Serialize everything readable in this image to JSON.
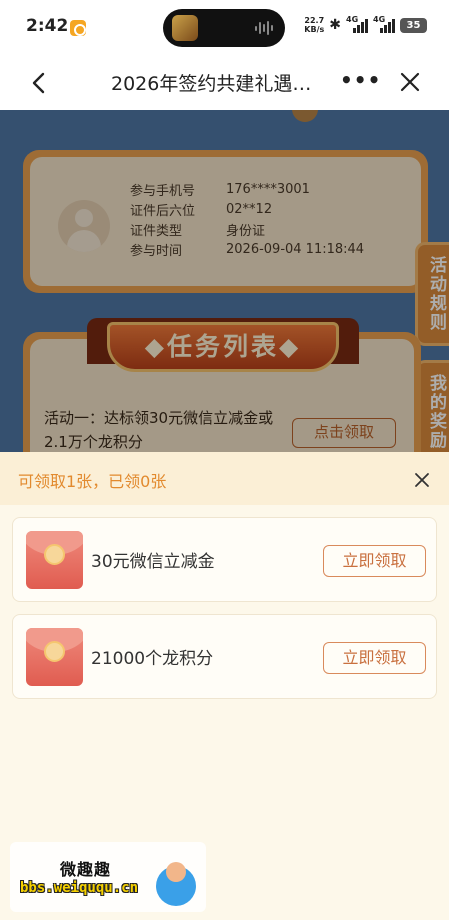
{
  "status_bar": {
    "time": "2:42",
    "net_speed_value": "22.7",
    "net_speed_unit": "KB/s",
    "signal_1_label": "4G",
    "signal_2_label": "4G",
    "battery": "35"
  },
  "title_bar": {
    "title": "2026年签约共建礼遇…"
  },
  "background_page": {
    "info_card": {
      "rows": [
        {
          "label": "参与手机号",
          "value": "176****3001"
        },
        {
          "label": "证件后六位",
          "value": "02**12"
        },
        {
          "label": "证件类型",
          "value": "身份证"
        },
        {
          "label": "参与时间",
          "value": "2026-09-04 11:18:44"
        }
      ]
    },
    "side_tabs": {
      "rules": "活动规则",
      "my_rewards": "我的奖励"
    },
    "task_section": {
      "banner": "◆任务列表◆",
      "activity_text": "活动一：达标领30元微信立减金或2.1万个龙积分",
      "claim_button": "点击领取"
    }
  },
  "sheet": {
    "header_text": "可领取1张，已领0张",
    "coupons": [
      {
        "title": "30元微信立减金",
        "button": "立即领取"
      },
      {
        "title": "21000个龙积分",
        "button": "立即领取"
      }
    ]
  },
  "watermark": {
    "name": "微趣趣",
    "url": "bbs.weiququ.cn"
  },
  "colors": {
    "accent_orange": "#e28a2e",
    "sheet_bg": "#fdf8ea",
    "button_border": "#d98a5c",
    "page_bg": "#4e77a4"
  }
}
